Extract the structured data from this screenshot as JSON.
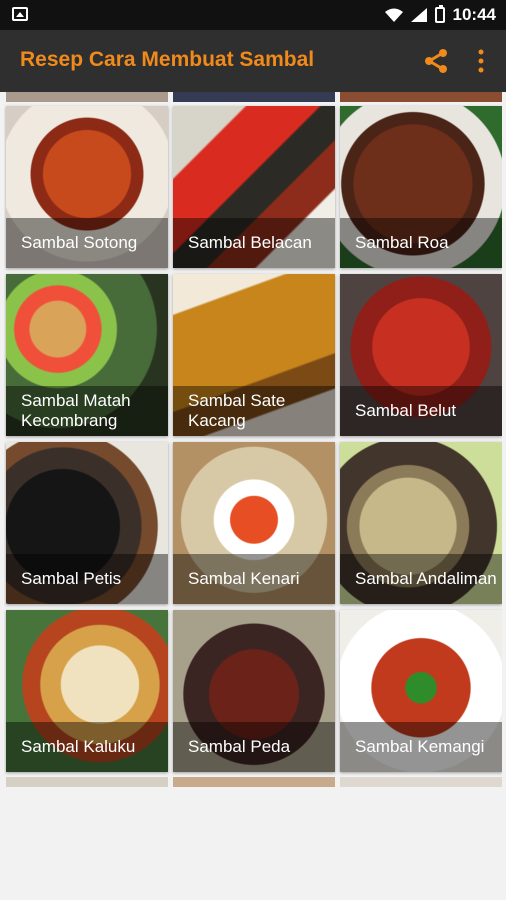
{
  "status": {
    "time": "10:44"
  },
  "app": {
    "title": "Resep Cara Membuat Sambal"
  },
  "recipes": [
    {
      "label": "Sambal Sotong"
    },
    {
      "label": "Sambal Belacan"
    },
    {
      "label": "Sambal Roa"
    },
    {
      "label": "Sambal Matah Kecombrang"
    },
    {
      "label": "Sambal Sate Kacang"
    },
    {
      "label": "Sambal Belut"
    },
    {
      "label": "Sambal Petis"
    },
    {
      "label": "Sambal Kenari"
    },
    {
      "label": "Sambal Andaliman"
    },
    {
      "label": "Sambal Kaluku"
    },
    {
      "label": "Sambal Peda"
    },
    {
      "label": "Sambal Kemangi"
    }
  ],
  "colors": {
    "accent": "#f08a1b",
    "appbar": "#2f2f2f",
    "statusbar": "#111111"
  }
}
